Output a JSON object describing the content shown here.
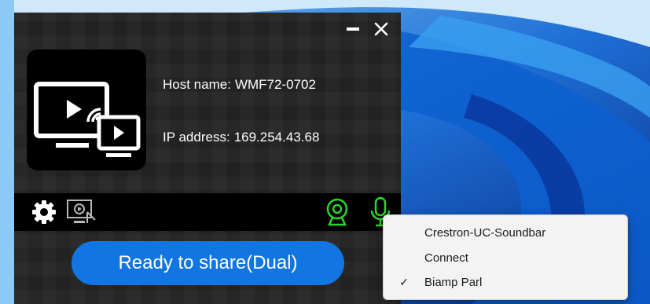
{
  "app": {
    "host_label": "Host name:",
    "host_value": "WMF72-0702",
    "ip_label": "IP address:",
    "ip_value": "169.254.43.68",
    "share_button": "Ready to share(Dual)",
    "icons": {
      "minimize": "minimize-icon",
      "close": "close-icon",
      "logo": "screen-cast-icon",
      "settings": "gear-icon",
      "screen_share_mode": "screen-share-icon",
      "camera": "webcam-icon",
      "microphone": "microphone-icon"
    },
    "colors": {
      "accent_blue": "#1276e2",
      "device_green": "#2bd62b",
      "panel": "#242424",
      "toolbar": "#000000"
    }
  },
  "context_menu": {
    "items": [
      {
        "label": "Crestron-UC-Soundbar",
        "checked": false
      },
      {
        "label": "Connect",
        "checked": false
      },
      {
        "label": "Biamp Parl",
        "checked": true
      }
    ],
    "check_glyph": "✓"
  }
}
